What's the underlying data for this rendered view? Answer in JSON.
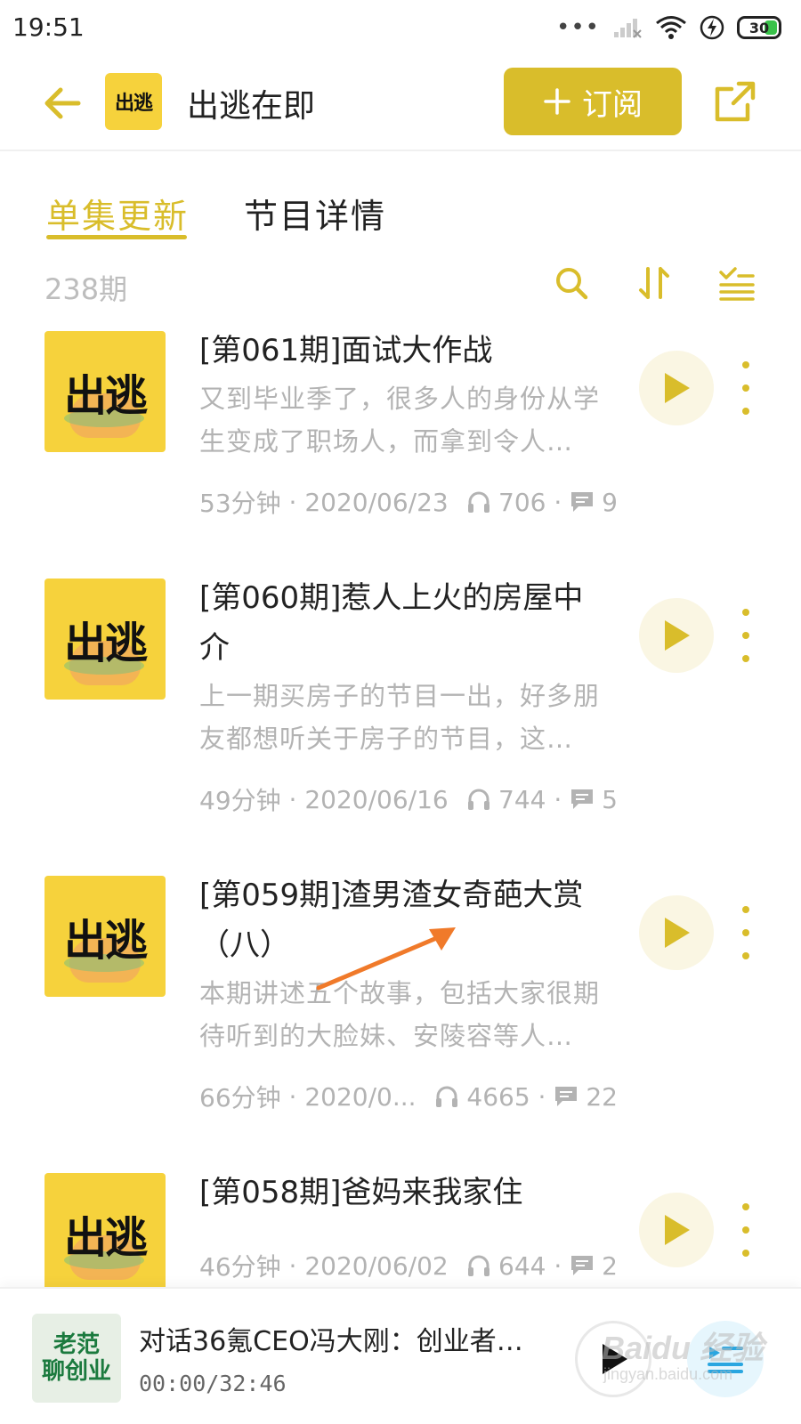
{
  "status_bar": {
    "time": "19:51",
    "battery": "30",
    "icons": [
      "signal-dots-icon",
      "cellular-signal-icon",
      "wifi-icon",
      "charging-icon",
      "battery-icon"
    ]
  },
  "header": {
    "title": "出逃在即",
    "logo_text": "出逃",
    "subscribe_label": "订阅",
    "colors": {
      "accent": "#d9bd2b",
      "cover": "#f6d23c"
    }
  },
  "tabs": [
    {
      "label": "单集更新",
      "active": true
    },
    {
      "label": "节目详情",
      "active": false
    }
  ],
  "toolbar": {
    "count": "238期",
    "icons": [
      "search-icon",
      "sort-icon",
      "filter-list-icon"
    ]
  },
  "episodes": [
    {
      "cover_text": "出逃",
      "title": "[第061期]面试大作战",
      "desc": "又到毕业季了，很多人的身份从学生变成了职场人，而拿到令人…",
      "duration": "53分钟",
      "date": "2020/06/23",
      "plays": "706",
      "comments": "9"
    },
    {
      "cover_text": "出逃",
      "title": "[第060期]惹人上火的房屋中介",
      "desc": "上一期买房子的节目一出，好多朋友都想听关于房子的节目，这…",
      "duration": "49分钟",
      "date": "2020/06/16",
      "plays": "744",
      "comments": "5"
    },
    {
      "cover_text": "出逃",
      "title": "[第059期]渣男渣女奇葩大赏（八）",
      "desc": "本期讲述五个故事，包括大家很期待听到的大脸妹、安陵容等人…",
      "duration": "66分钟",
      "date": "2020/0...",
      "plays": "4665",
      "comments": "22"
    },
    {
      "cover_text": "出逃",
      "title": "[第058期]爸妈来我家住",
      "desc": "",
      "duration": "46分钟",
      "date": "2020/06/02",
      "plays": "644",
      "comments": "2"
    }
  ],
  "player": {
    "cover_line1": "老范",
    "cover_line2": "聊创业",
    "title": "对话36氪CEO冯大刚：创业者…",
    "time": "00:00/32:46"
  },
  "watermark": {
    "brand": "Baidu 经验",
    "url": "jingyan.baidu.com"
  }
}
